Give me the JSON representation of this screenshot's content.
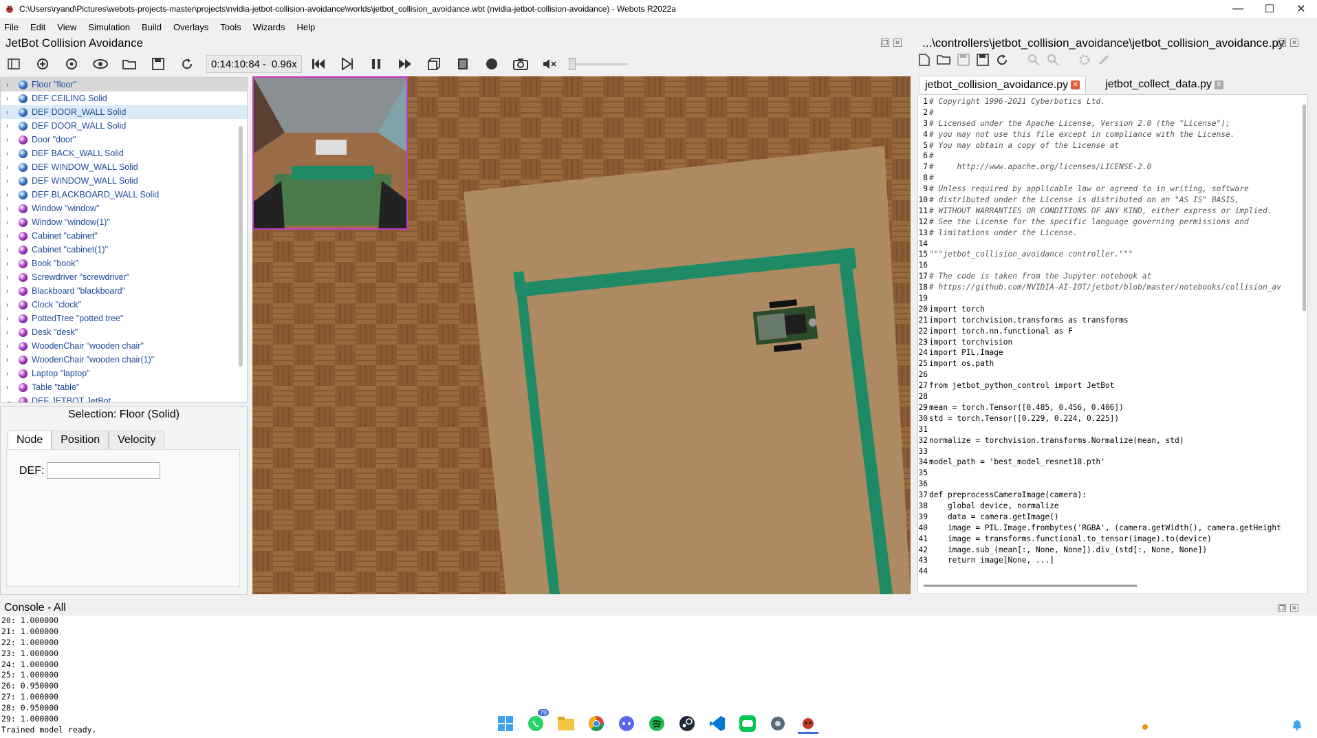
{
  "window": {
    "title": "C:\\Users\\ryand\\Pictures\\webots-projects-master\\projects\\nvidia-jetbot-collision-avoidance\\worlds\\jetbot_collision_avoidance.wbt (nvidia-jetbot-collision-avoidance) - Webots R2022a",
    "minimize": "—",
    "maximize": "☐",
    "close": "✕"
  },
  "menu": [
    "File",
    "Edit",
    "View",
    "Simulation",
    "Build",
    "Overlays",
    "Tools",
    "Wizards",
    "Help"
  ],
  "scene": {
    "title": "JetBot Collision Avoidance",
    "time": "0:14:10:84",
    "time_sep": "-",
    "speed": "0.96x",
    "tree": [
      {
        "label": "Floor \"floor\"",
        "color": "#3b7dd8",
        "state": "sel"
      },
      {
        "label": "DEF CEILING Solid",
        "color": "#3b7dd8",
        "state": ""
      },
      {
        "label": "DEF DOOR_WALL Solid",
        "color": "#3b7dd8",
        "state": "hl"
      },
      {
        "label": "DEF DOOR_WALL Solid",
        "color": "#3b7dd8",
        "state": ""
      },
      {
        "label": "Door \"door\"",
        "color": "#b23bd0",
        "state": ""
      },
      {
        "label": "DEF BACK_WALL Solid",
        "color": "#3b7dd8",
        "state": ""
      },
      {
        "label": "DEF WINDOW_WALL Solid",
        "color": "#3b7dd8",
        "state": ""
      },
      {
        "label": "DEF WINDOW_WALL Solid",
        "color": "#3b7dd8",
        "state": ""
      },
      {
        "label": "DEF BLACKBOARD_WALL Solid",
        "color": "#3b7dd8",
        "state": ""
      },
      {
        "label": "Window \"window\"",
        "color": "#b23bd0",
        "state": ""
      },
      {
        "label": "Window \"window(1)\"",
        "color": "#b23bd0",
        "state": ""
      },
      {
        "label": "Cabinet \"cabinet\"",
        "color": "#b23bd0",
        "state": ""
      },
      {
        "label": "Cabinet \"cabinet(1)\"",
        "color": "#b23bd0",
        "state": ""
      },
      {
        "label": "Book \"book\"",
        "color": "#b23bd0",
        "state": ""
      },
      {
        "label": "Screwdriver \"screwdriver\"",
        "color": "#b23bd0",
        "state": ""
      },
      {
        "label": "Blackboard \"blackboard\"",
        "color": "#b23bd0",
        "state": ""
      },
      {
        "label": "Clock \"clock\"",
        "color": "#b23bd0",
        "state": ""
      },
      {
        "label": "PottedTree \"potted tree\"",
        "color": "#b23bd0",
        "state": ""
      },
      {
        "label": "Desk \"desk\"",
        "color": "#b23bd0",
        "state": ""
      },
      {
        "label": "WoodenChair \"wooden chair\"",
        "color": "#b23bd0",
        "state": ""
      },
      {
        "label": "WoodenChair \"wooden chair(1)\"",
        "color": "#b23bd0",
        "state": ""
      },
      {
        "label": "Laptop \"laptop\"",
        "color": "#b23bd0",
        "state": ""
      },
      {
        "label": "Table \"table\"",
        "color": "#b23bd0",
        "state": ""
      },
      {
        "label": "DEF JETBOT JetBot",
        "color": "#b23bd0",
        "state": ""
      }
    ],
    "selection_title": "Selection: Floor (Solid)",
    "tabs": [
      "Node",
      "Position",
      "Velocity"
    ],
    "def_label": "DEF:",
    "def_value": ""
  },
  "editor": {
    "title": "...\\controllers\\jetbot_collision_avoidance\\jetbot_collision_avoidance.py",
    "tabs": [
      {
        "label": "jetbot_collision_avoidance.py",
        "active": true
      },
      {
        "label": "jetbot_collect_data.py",
        "active": false
      }
    ],
    "lines": [
      {
        "n": "1",
        "t": "# Copyright 1996-2021 Cyberbotics Ltd.",
        "c": true
      },
      {
        "n": "2",
        "t": "#",
        "c": true
      },
      {
        "n": "3",
        "t": "# Licensed under the Apache License, Version 2.0 (the \"License\");",
        "c": true
      },
      {
        "n": "4",
        "t": "# you may not use this file except in compliance with the License.",
        "c": true
      },
      {
        "n": "5",
        "t": "# You may obtain a copy of the License at",
        "c": true
      },
      {
        "n": "6",
        "t": "#",
        "c": true
      },
      {
        "n": "7",
        "t": "#     http://www.apache.org/licenses/LICENSE-2.0",
        "c": true
      },
      {
        "n": "8",
        "t": "#",
        "c": true
      },
      {
        "n": "9",
        "t": "# Unless required by applicable law or agreed to in writing, software",
        "c": true
      },
      {
        "n": "10",
        "t": "# distributed under the License is distributed on an \"AS IS\" BASIS,",
        "c": true
      },
      {
        "n": "11",
        "t": "# WITHOUT WARRANTIES OR CONDITIONS OF ANY KIND, either express or implied.",
        "c": true
      },
      {
        "n": "12",
        "t": "# See the License for the specific language governing permissions and",
        "c": true
      },
      {
        "n": "13",
        "t": "# limitations under the License.",
        "c": true
      },
      {
        "n": "14",
        "t": "",
        "c": false
      },
      {
        "n": "15",
        "t": "\"\"\"jetbot_collision_avoidance controller.\"\"\"",
        "c": true
      },
      {
        "n": "16",
        "t": "",
        "c": false
      },
      {
        "n": "17",
        "t": "# The code is taken from the Jupyter notebook at",
        "c": true
      },
      {
        "n": "18",
        "t": "# https://github.com/NVIDIA-AI-IOT/jetbot/blob/master/notebooks/collision_av",
        "c": true
      },
      {
        "n": "19",
        "t": "",
        "c": false
      },
      {
        "n": "20",
        "t": "import torch",
        "c": false
      },
      {
        "n": "21",
        "t": "import torchvision.transforms as transforms",
        "c": false
      },
      {
        "n": "22",
        "t": "import torch.nn.functional as F",
        "c": false
      },
      {
        "n": "23",
        "t": "import torchvision",
        "c": false
      },
      {
        "n": "24",
        "t": "import PIL.Image",
        "c": false
      },
      {
        "n": "25",
        "t": "import os.path",
        "c": false
      },
      {
        "n": "26",
        "t": "",
        "c": false
      },
      {
        "n": "27",
        "t": "from jetbot_python_control import JetBot",
        "c": false
      },
      {
        "n": "28",
        "t": "",
        "c": false
      },
      {
        "n": "29",
        "t": "mean = torch.Tensor([0.485, 0.456, 0.406])",
        "c": false
      },
      {
        "n": "30",
        "t": "std = torch.Tensor([0.229, 0.224, 0.225])",
        "c": false
      },
      {
        "n": "31",
        "t": "",
        "c": false
      },
      {
        "n": "32",
        "t": "normalize = torchvision.transforms.Normalize(mean, std)",
        "c": false
      },
      {
        "n": "33",
        "t": "",
        "c": false
      },
      {
        "n": "34",
        "t": "model_path = 'best_model_resnet18.pth'",
        "c": false
      },
      {
        "n": "35",
        "t": "",
        "c": false
      },
      {
        "n": "36",
        "t": "",
        "c": false
      },
      {
        "n": "37",
        "t": "def preprocessCameraImage(camera):",
        "c": false
      },
      {
        "n": "38",
        "t": "    global device, normalize",
        "c": false
      },
      {
        "n": "39",
        "t": "    data = camera.getImage()",
        "c": false
      },
      {
        "n": "40",
        "t": "    image = PIL.Image.frombytes('RGBA', (camera.getWidth(), camera.getHeight",
        "c": false
      },
      {
        "n": "41",
        "t": "    image = transforms.functional.to_tensor(image).to(device)",
        "c": false
      },
      {
        "n": "42",
        "t": "    image.sub_(mean[:, None, None]).div_(std[:, None, None])",
        "c": false
      },
      {
        "n": "43",
        "t": "    return image[None, ...]",
        "c": false
      },
      {
        "n": "44",
        "t": "",
        "c": false
      }
    ]
  },
  "console": {
    "title": "Console - All",
    "lines": [
      "20: 1.000000",
      "21: 1.000000",
      "22: 1.000000",
      "23: 1.000000",
      "24: 1.000000",
      "25: 1.000000",
      "26: 0.950000",
      "27: 1.000000",
      "28: 0.950000",
      "29: 1.000000",
      "Trained model ready."
    ]
  },
  "taskbar": {
    "whatsapp_badge": "79",
    "icons": [
      "windows-start-icon",
      "whatsapp-icon",
      "file-explorer-icon",
      "chrome-icon",
      "discord-icon",
      "spotify-icon",
      "steam-icon",
      "vscode-icon",
      "line-icon",
      "settings-icon",
      "webots-icon"
    ]
  }
}
